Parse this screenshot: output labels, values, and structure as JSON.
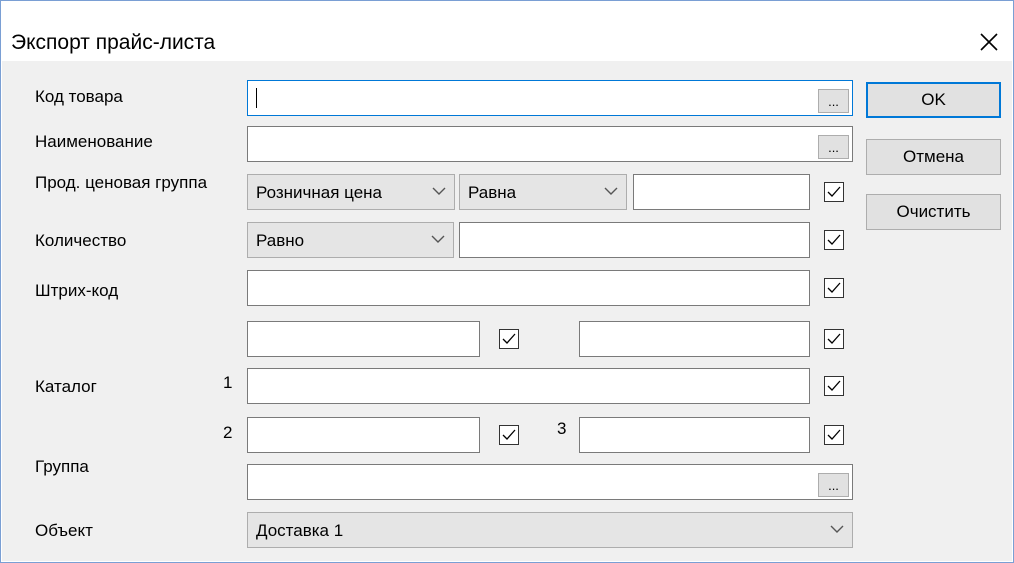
{
  "window": {
    "title": "Экспорт прайс-листа",
    "close_glyph": "✕"
  },
  "labels": {
    "product_code": "Код товара",
    "name": "Наименование",
    "price_group": "Прод. ценовая группа",
    "quantity": "Количество",
    "barcode": "Штрих-код",
    "catalog": "Каталог",
    "group": "Группа",
    "object": "Объект",
    "catalog_1": "1",
    "catalog_2": "2",
    "catalog_3": "3"
  },
  "fields": {
    "product_code": "",
    "name": "",
    "price_value": "",
    "quantity_value": "",
    "barcode": "",
    "extra_1": "",
    "extra_2": "",
    "catalog_1": "",
    "catalog_2": "",
    "catalog_3": "",
    "group": ""
  },
  "ellipsis_label": "...",
  "selects": {
    "price_type": "Розничная цена",
    "price_condition": "Равна",
    "quantity_condition": "Равно",
    "object": "Доставка 1"
  },
  "checkboxes": {
    "price": true,
    "quantity": true,
    "barcode": true,
    "extra_1": true,
    "extra_2": true,
    "catalog_1": true,
    "catalog_2": true,
    "catalog_3": true
  },
  "buttons": {
    "ok": "OK",
    "cancel": "Отмена",
    "clear": "Очистить"
  },
  "colors": {
    "focus_accent": "#0078d7",
    "window_border": "#7a9fd4",
    "client_background": "#f0f0f0"
  }
}
